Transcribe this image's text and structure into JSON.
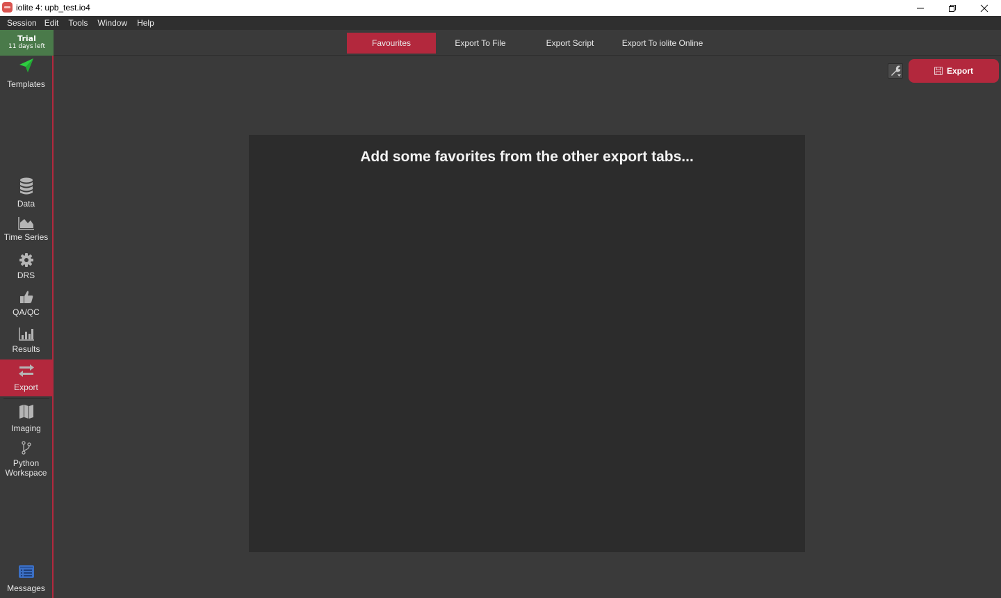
{
  "window": {
    "title": "iolite 4: upb_test.io4",
    "controls": {
      "minimize": "—",
      "maximize": "❐",
      "close": "✕"
    }
  },
  "menubar": {
    "items": [
      "Session",
      "Edit",
      "Tools",
      "Window",
      "Help"
    ]
  },
  "trial": {
    "title": "Trial",
    "subtitle": "11 days left",
    "color": "#4a7a4a"
  },
  "tabs": [
    {
      "label": "Favourites",
      "active": true
    },
    {
      "label": "Export To File",
      "active": false
    },
    {
      "label": "Export Script",
      "active": false
    },
    {
      "label": "Export To iolite Online",
      "active": false
    }
  ],
  "sidebar": {
    "items": [
      {
        "label": "Templates",
        "icon": "paper-plane-icon"
      },
      {
        "label": "Data",
        "icon": "database-icon"
      },
      {
        "label": "Time Series",
        "icon": "area-chart-icon"
      },
      {
        "label": "DRS",
        "icon": "gear-icon"
      },
      {
        "label": "QA/QC",
        "icon": "thumbs-up-icon"
      },
      {
        "label": "Results",
        "icon": "bar-chart-icon"
      },
      {
        "label": "Export",
        "icon": "exchange-arrows-icon",
        "active": true
      },
      {
        "label": "Imaging",
        "icon": "map-icon"
      },
      {
        "label": "Python Workspace",
        "label_line1": "Python",
        "label_line2": "Workspace",
        "icon": "code-branch-icon"
      },
      {
        "label": "Messages",
        "icon": "message-list-icon"
      }
    ]
  },
  "toolbar": {
    "tools_icon": "wrench-icon",
    "export_label": "Export",
    "export_icon": "floppy-disk-icon"
  },
  "panel": {
    "message": "Add some favorites from the other export tabs..."
  },
  "colors": {
    "accent": "#b3283d",
    "background": "#3a3a3a",
    "panel": "#2c2c2c",
    "templates_icon": "#2ecc40",
    "messages_icon": "#3b6fc4"
  }
}
